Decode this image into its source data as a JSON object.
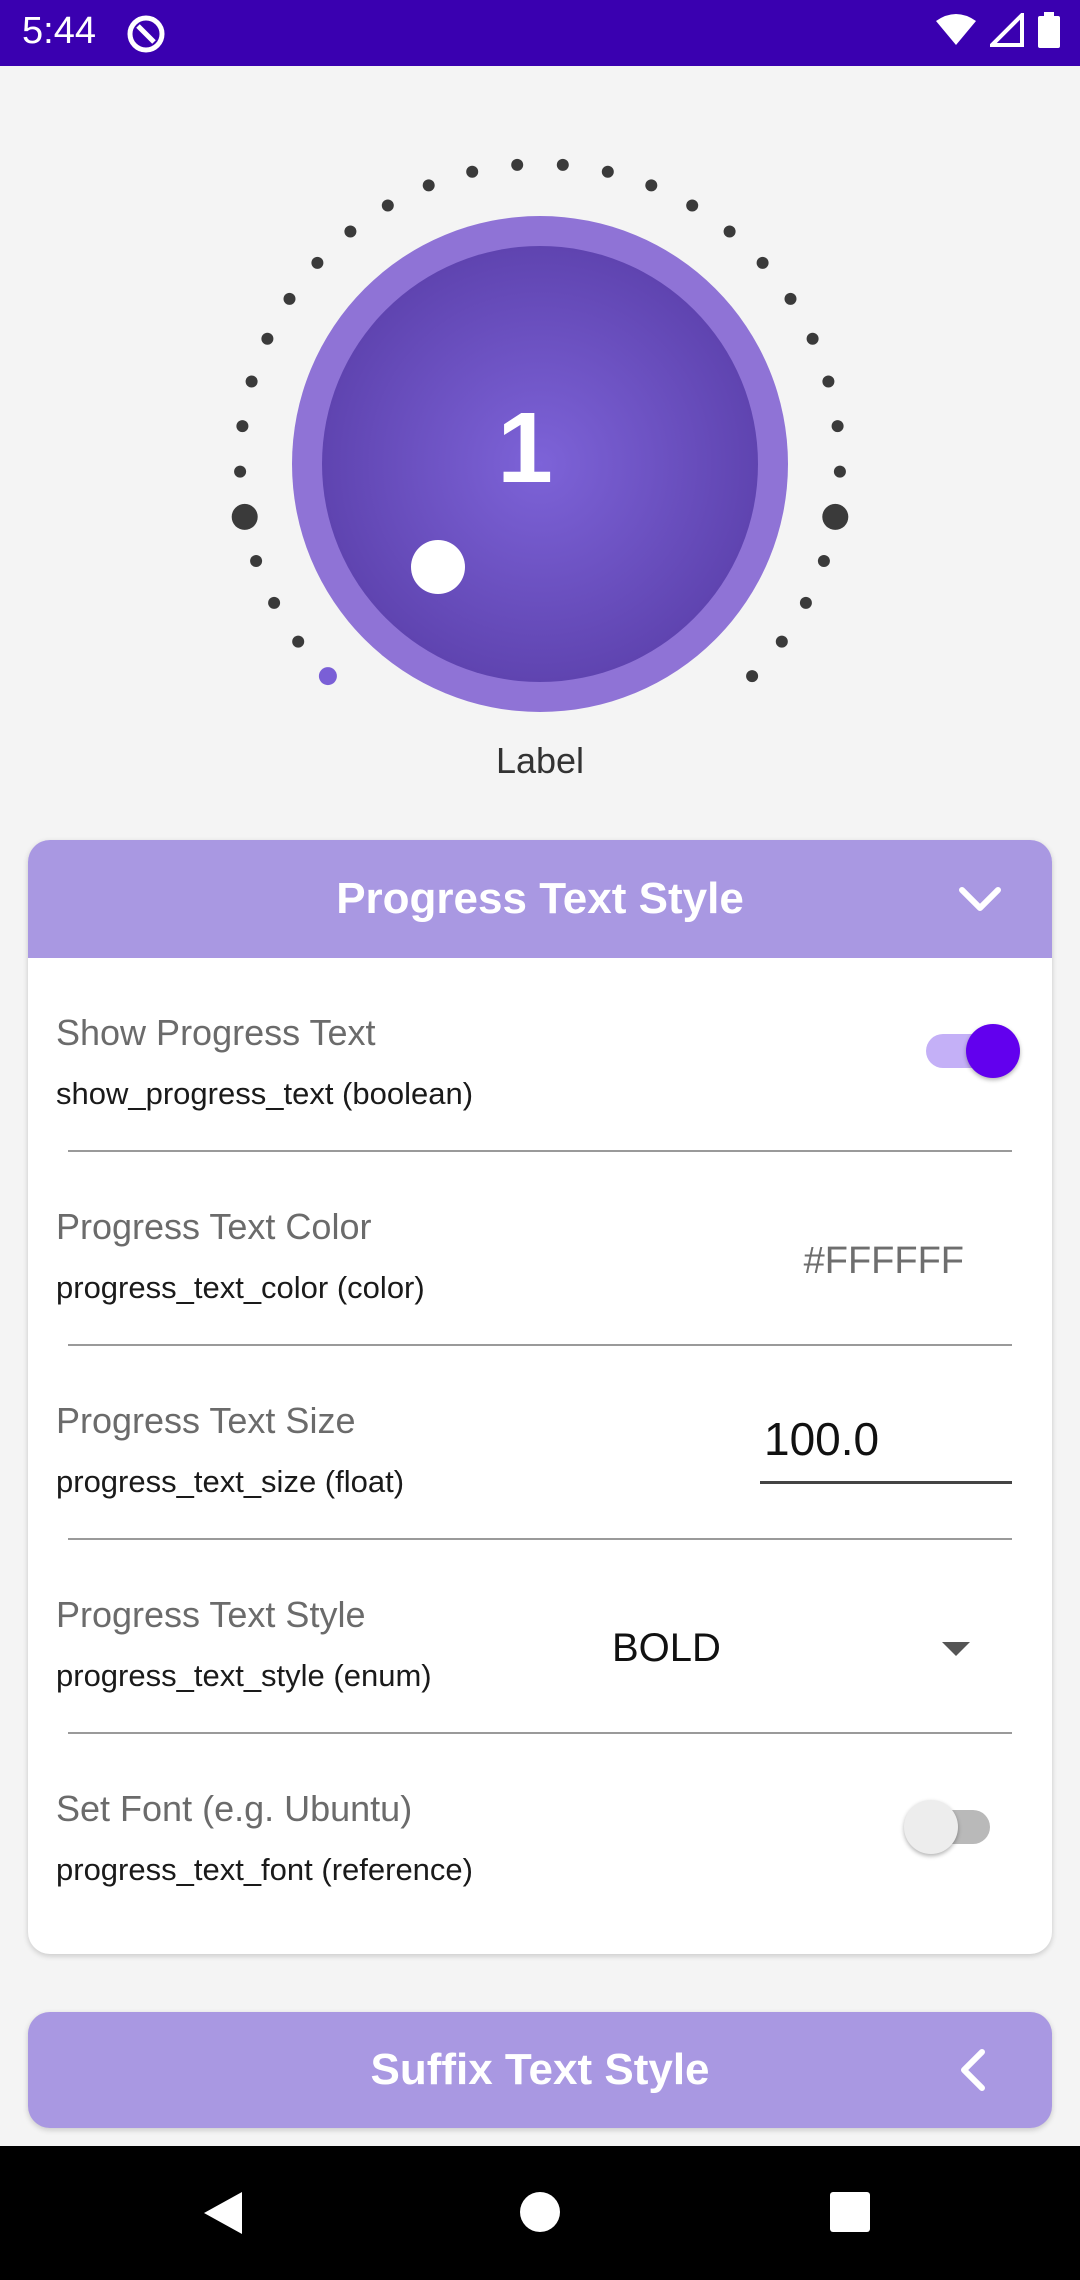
{
  "status_bar": {
    "time": "5:44"
  },
  "knob": {
    "value": "1",
    "label": "Label",
    "progress": 0.0,
    "accent": "#7a5fd6",
    "ring": "#8f73d6"
  },
  "section": {
    "title": "Progress Text Style",
    "rows": [
      {
        "title": "Show Progress Text",
        "subtitle": "show_progress_text (boolean)",
        "toggle_on": true
      },
      {
        "title": "Progress Text Color",
        "subtitle": "progress_text_color (color)",
        "value": "#FFFFFF"
      },
      {
        "title": "Progress Text Size",
        "subtitle": "progress_text_size (float)",
        "value": "100.0"
      },
      {
        "title": "Progress Text Style",
        "subtitle": "progress_text_style (enum)",
        "value": "BOLD"
      },
      {
        "title": "Set Font (e.g. Ubuntu)",
        "subtitle": "progress_text_font (reference)",
        "toggle_on": false
      }
    ]
  },
  "section2": {
    "title": "Suffix Text Style"
  },
  "colors": {
    "header": "#a998e2",
    "status_bar": "#3a00b0",
    "switch_on": "#6200ee"
  }
}
